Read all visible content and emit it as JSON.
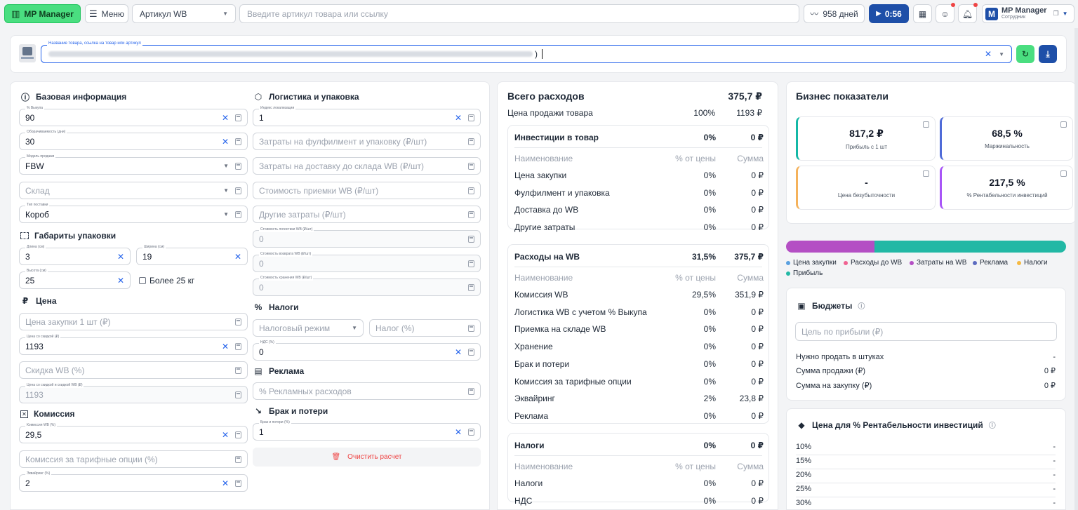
{
  "topbar": {
    "logo": "MP Manager",
    "menu": "Меню",
    "article_select": "Артикул WB",
    "search_placeholder": "Введите артикул товара или ссылку",
    "days": "958 дней",
    "timer": "0:56",
    "user_name": "MP Manager",
    "user_role": "Сотрудник",
    "avatar_letter": "M"
  },
  "product": {
    "label": "Название товара, ссылка на товар или артикул",
    "value": ")"
  },
  "basic": {
    "title": "Базовая информация",
    "buyout_label": "% Выкупа",
    "buyout": "90",
    "turnover_label": "Оборачиваемость (дни)",
    "turnover": "30",
    "model_label": "Модель продажи",
    "model": "FBW",
    "warehouse_ph": "Склад",
    "supply_label": "Тип поставки",
    "supply": "Короб"
  },
  "dims": {
    "title": "Габариты упаковки",
    "length_label": "Длина (см)",
    "length": "3",
    "width_label": "Ширина (см)",
    "width": "19",
    "height_label": "Высота (см)",
    "height": "25",
    "heavy": "Более 25 кг"
  },
  "price": {
    "title": "Цена",
    "purchase_ph": "Цена закупки 1 шт (₽)",
    "discount_price_label": "Цена со скидкой (₽)",
    "discount_price": "1193",
    "wb_discount_ph": "Скидка WB (%)",
    "wb_price_label": "Цена со скидкой и скидкой WB (₽)",
    "wb_price": "1193"
  },
  "commission": {
    "title": "Комиссия",
    "wb_label": "Комиссия WB (%)",
    "wb": "29,5",
    "tariff_ph": "Комиссия за тарифные опции (%)",
    "acq_label": "Эквайринг (%)",
    "acq": "2"
  },
  "logistics": {
    "title": "Логистика и упаковка",
    "index_label": "Индекс локализации",
    "index": "1",
    "fulfil_ph": "Затраты на фулфилмент и упаковку (₽/шт)",
    "delivery_ph": "Затраты на доставку до склада WB (₽/шт)",
    "accept_ph": "Стоимость приемки WB (₽/шт)",
    "other_ph": "Другие затраты (₽/шт)",
    "logcost_label": "Стоимость логистики WB (₽/шт)",
    "logcost": "0",
    "return_label": "Стоимость возврата WB (₽/шт)",
    "return": "0",
    "storage_label": "Стоимость хранения WB (₽/шт)",
    "storage": "0"
  },
  "taxes": {
    "title": "Налоги",
    "regime_ph": "Налоговый режим",
    "tax_ph": "Налог (%)",
    "vat_label": "НДС (%)",
    "vat": "0"
  },
  "ads": {
    "title": "Реклама",
    "ph": "% Рекламных расходов"
  },
  "defect": {
    "title": "Брак и потери",
    "label": "Брак и потери (%)",
    "value": "1",
    "clear": "Очистить расчет"
  },
  "expenses": {
    "title": "Всего расходов",
    "total": "375,7 ₽",
    "sale_label": "Цена продажи товара",
    "sale_pct": "100%",
    "sale_sum": "1193 ₽",
    "col_name": "Наименование",
    "col_pct": "% от цены",
    "col_sum": "Сумма",
    "groups": [
      {
        "title": "Инвестиции в товар",
        "pct": "0%",
        "sum": "0 ₽",
        "rows": [
          [
            "Цена закупки",
            "0%",
            "0 ₽"
          ],
          [
            "Фулфилмент и упаковка",
            "0%",
            "0 ₽"
          ],
          [
            "Доставка до WB",
            "0%",
            "0 ₽"
          ],
          [
            "Другие затраты",
            "0%",
            "0 ₽"
          ]
        ]
      },
      {
        "title": "Расходы на WB",
        "pct": "31,5%",
        "sum": "375,7 ₽",
        "rows": [
          [
            "Комиссия WB",
            "29,5%",
            "351,9 ₽"
          ],
          [
            "Логистика WB с учетом % Выкупа",
            "0%",
            "0 ₽"
          ],
          [
            "Приемка на складе WB",
            "0%",
            "0 ₽"
          ],
          [
            "Хранение",
            "0%",
            "0 ₽"
          ],
          [
            "Брак и потери",
            "0%",
            "0 ₽"
          ],
          [
            "Комиссия за тарифные опции",
            "0%",
            "0 ₽"
          ],
          [
            "Эквайринг",
            "2%",
            "23,8 ₽"
          ],
          [
            "Реклама",
            "0%",
            "0 ₽"
          ]
        ]
      },
      {
        "title": "Налоги",
        "pct": "0%",
        "sum": "0 ₽",
        "rows": [
          [
            "Налоги",
            "0%",
            "0 ₽"
          ],
          [
            "НДС",
            "0%",
            "0 ₽"
          ]
        ]
      }
    ]
  },
  "business": {
    "title": "Бизнес показатели",
    "m1_value": "817,2 ₽",
    "m1_label": "Прибыль с 1 шт",
    "m1_color": "#14b8a6",
    "m2_value": "68,5 %",
    "m2_label": "Маржинальность",
    "m2_color": "#4f6bd8",
    "m3_value": "-",
    "m3_label": "Цена безубыточности",
    "m3_color": "#f5b25b",
    "m4_value": "217,5 %",
    "m4_label": "% Рентабельности инвестиций",
    "m4_color": "#a855f7",
    "bar": [
      {
        "frac": 0.315,
        "color": "#b44fc4"
      },
      {
        "frac": 0.685,
        "color": "#22b8a5"
      }
    ],
    "legend": [
      {
        "label": "Цена закупки",
        "color": "#5aa0e0"
      },
      {
        "label": "Расходы до WB",
        "color": "#f06292"
      },
      {
        "label": "Затраты на WB",
        "color": "#b44fc4"
      },
      {
        "label": "Реклама",
        "color": "#5c6bc0"
      },
      {
        "label": "Налоги",
        "color": "#f5b942"
      },
      {
        "label": "Прибыль",
        "color": "#22b8a5"
      }
    ]
  },
  "budget": {
    "title": "Бюджеты",
    "goal_ph": "Цель по прибыли (₽)",
    "sell_label": "Нужно продать в штуках",
    "sell": "-",
    "sales_label": "Сумма продажи (₽)",
    "sales": "0 ₽",
    "purchase_label": "Сумма на закупку (₽)",
    "purchase": "0 ₽"
  },
  "roi": {
    "title": "Цена для % Рентабельности инвестиций",
    "rows": [
      [
        "10%",
        "-"
      ],
      [
        "15%",
        "-"
      ],
      [
        "20%",
        "-"
      ],
      [
        "25%",
        "-"
      ],
      [
        "30%",
        "-"
      ]
    ]
  }
}
